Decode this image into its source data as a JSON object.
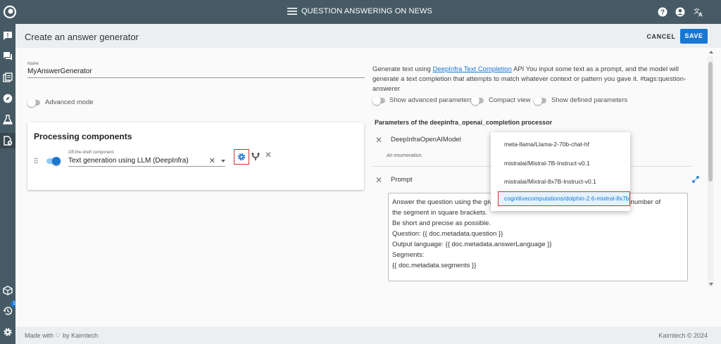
{
  "topbar": {
    "title": "QUESTION ANSWERING ON NEWS",
    "icons": [
      "app-logo-icon",
      "menu-icon",
      "help-icon",
      "account-icon",
      "translate-icon"
    ]
  },
  "rail": {
    "icons": [
      "feedback-icon",
      "chat-icon",
      "documents-icon",
      "explore-icon",
      "flask-icon",
      "new-document-icon",
      "cube-icon",
      "history-icon",
      "settings-icon"
    ],
    "history_badge": "1"
  },
  "header": {
    "page_title": "Create an answer generator",
    "cancel_label": "CANCEL",
    "save_label": "SAVE",
    "accent_color": "#1976d2"
  },
  "form": {
    "name_label": "Name",
    "name_value": "MyAnswerGenerator",
    "advanced_mode_label": "Advanced mode",
    "advanced_mode_on": false
  },
  "processing": {
    "title": "Processing components",
    "component_label": "Off-the-shelf component",
    "component_value": "Text generation using LLM (DeepInfra)",
    "component_enabled": true,
    "clear_symbol": "✕"
  },
  "right": {
    "desc_before": "Generate text using ",
    "desc_link": "DeepInfra Text Completion",
    "desc_after": " API You input some text as a prompt, and the model will generate a text completion that attempts to match whatever context or pattern you gave it. #tags:question-answerer",
    "show_advanced_label": "Show advanced parameters",
    "compact_view_label": "Compact view",
    "show_defined_label": "Show defined parameters",
    "params_title": "Parameters of the deepinfra_openai_completion processor",
    "model_param_name": "DeepInfraOpenAIModel",
    "model_param_desc": "An enumeration.",
    "prompt_param_name": "Prompt",
    "prompt_lines": [
      "Answer the question using the given",
      "the segment in square brackets.",
      "Be short and precise as possible.",
      "Question: {{ doc.metadata.question }}",
      "Output language: {{ doc.metadata.answerLanguage }}",
      "Segments:",
      "{{ doc.metadata.segments }}"
    ],
    "prompt_line1_tail": "sing the number of"
  },
  "dropdown": {
    "options": [
      "meta-llama/Llama-2-70b-chat-hf",
      "mistralai/Mistral-7B-Instruct-v0.1",
      "mistralai/Mixtral-8x7B-Instruct-v0.1",
      "cognitivecomputations/dolphin-2.6-mixtral-8x7b"
    ],
    "selected_index": 3
  },
  "footer": {
    "left": "Made with ♡ by Kairntech",
    "right": "Kairntech © 2024"
  }
}
